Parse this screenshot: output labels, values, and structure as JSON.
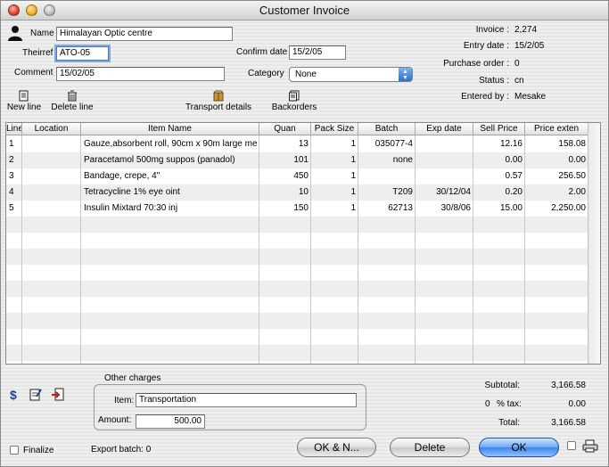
{
  "window": {
    "title": "Customer Invoice"
  },
  "form": {
    "name_label": "Name",
    "name_value": "Himalayan Optic centre",
    "theirref_label": "Theirref",
    "theirref_value": "ATO-05",
    "comment_label": "Comment",
    "comment_value": "15/02/05",
    "confirm_label": "Confirm date",
    "confirm_value": "15/2/05",
    "category_label": "Category",
    "category_value": "None"
  },
  "info": {
    "invoice_label": "Invoice :",
    "invoice_value": "2,274",
    "entry_label": "Entry date :",
    "entry_value": "15/2/05",
    "po_label": "Purchase order :",
    "po_value": "0",
    "status_label": "Status :",
    "status_value": "cn",
    "enteredby_label": "Entered by :",
    "enteredby_value": "Mesake"
  },
  "toolbar": {
    "new_line": "New line",
    "delete_line": "Delete line",
    "transport": "Transport details",
    "backorders": "Backorders"
  },
  "table": {
    "headers": [
      "Line",
      "Location",
      "Item Name",
      "Quan",
      "Pack Size",
      "Batch",
      "Exp date",
      "Sell Price",
      "Price exten"
    ],
    "rows": [
      [
        "1",
        "",
        "Gauze,absorbent roll, 90cm x 90m large me",
        "13",
        "1",
        "035077-4",
        "",
        "12.16",
        "158.08"
      ],
      [
        "2",
        "",
        "Paracetamol 500mg suppos (panadol)",
        "101",
        "1",
        "none",
        "",
        "0.00",
        "0.00"
      ],
      [
        "3",
        "",
        "Bandage, crepe, 4\"",
        "450",
        "1",
        "",
        "",
        "0.57",
        "256.50"
      ],
      [
        "4",
        "",
        "Tetracycline 1% eye oint",
        "10",
        "1",
        "T209",
        "30/12/04",
        "0.20",
        "2.00"
      ],
      [
        "5",
        "",
        "Insulin Mixtard 70:30 inj",
        "150",
        "1",
        "62713",
        "30/8/06",
        "15.00",
        "2,250.00"
      ]
    ]
  },
  "charges": {
    "group_label": "Other charges",
    "item_label": "Item:",
    "item_value": "Transportation",
    "amount_label": "Amount:",
    "amount_value": "500.00"
  },
  "totals": {
    "subtotal_label": "Subtotal:",
    "subtotal_value": "3,166.58",
    "tax_rate": "0",
    "tax_label": "% tax:",
    "tax_value": "0.00",
    "total_label": "Total:",
    "total_value": "3,166.58"
  },
  "footer": {
    "finalize_label": "Finalize",
    "export_batch": "Export batch: 0",
    "ok_n_label": "OK & N...",
    "delete_label": "Delete",
    "ok_label": "OK"
  },
  "colors": {
    "accent": "#3d86ea",
    "row_alt": "#eeeeee"
  }
}
